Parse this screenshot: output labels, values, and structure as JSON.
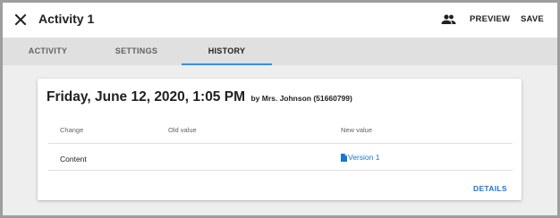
{
  "topbar": {
    "title": "Activity 1",
    "close_icon": "close-icon",
    "people_icon": "people-icon",
    "preview_label": "PREVIEW",
    "save_label": "SAVE"
  },
  "tabs": [
    {
      "label": "ACTIVITY",
      "active": false
    },
    {
      "label": "SETTINGS",
      "active": false
    },
    {
      "label": "HISTORY",
      "active": true
    }
  ],
  "history": {
    "date": "Friday, June 12, 2020, 1:05 PM",
    "by": "by Mrs. Johnson (51660799)",
    "columns": [
      "Change",
      "Old value",
      "New value"
    ],
    "rows": [
      {
        "change": "Content",
        "old_value": "",
        "new_value": "Version 1",
        "new_value_icon": "document-icon"
      }
    ],
    "details_label": "DETAILS"
  },
  "colors": {
    "accent": "#2196f3",
    "link": "#1976d2",
    "background": "#eeeeee",
    "tabbar": "#e0e0e0"
  }
}
